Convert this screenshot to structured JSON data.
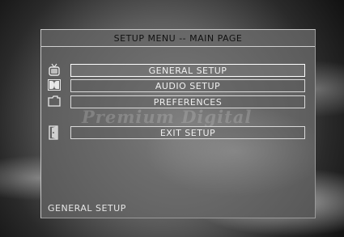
{
  "menu": {
    "title": "SETUP MENU -- MAIN PAGE",
    "items": [
      {
        "label": "GENERAL SETUP",
        "icon": "tv-icon"
      },
      {
        "label": "AUDIO SETUP",
        "icon": "dolby-icon"
      },
      {
        "label": "PREFERENCES",
        "icon": "folder-icon"
      },
      {
        "label": "EXIT SETUP",
        "icon": "exit-door-icon"
      }
    ],
    "selected": "GENERAL SETUP"
  },
  "watermark": "Premium Digital",
  "status": "GENERAL SETUP"
}
